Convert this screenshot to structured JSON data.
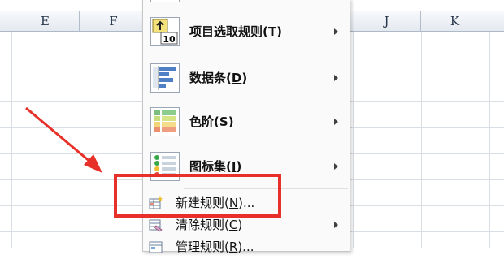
{
  "columns": {
    "left": [
      "E",
      "F"
    ],
    "right": [
      "J",
      "K"
    ]
  },
  "menu": {
    "items": [
      {
        "label": "项目选取规则",
        "mnemonic": "T",
        "has_submenu": true,
        "icon": "top-10-rules-icon"
      },
      {
        "label": "数据条",
        "mnemonic": "D",
        "has_submenu": true,
        "icon": "data-bars-icon"
      },
      {
        "label": "色阶",
        "mnemonic": "S",
        "has_submenu": true,
        "icon": "color-scales-icon"
      },
      {
        "label": "图标集",
        "mnemonic": "I",
        "has_submenu": true,
        "icon": "icon-sets-icon"
      }
    ],
    "new_rule": {
      "label": "新建规则",
      "mnemonic": "N",
      "suffix": "...",
      "icon": "new-rule-icon"
    },
    "clear_rules": {
      "label": "清除规则",
      "mnemonic": "C",
      "has_submenu": true,
      "icon": "clear-rules-icon"
    },
    "manage_rules": {
      "label": "管理规则",
      "mnemonic": "R",
      "suffix": "...",
      "icon": "manage-rules-icon"
    },
    "top10_icon_text": "10"
  },
  "annotation": {
    "color": "#e8302a"
  }
}
